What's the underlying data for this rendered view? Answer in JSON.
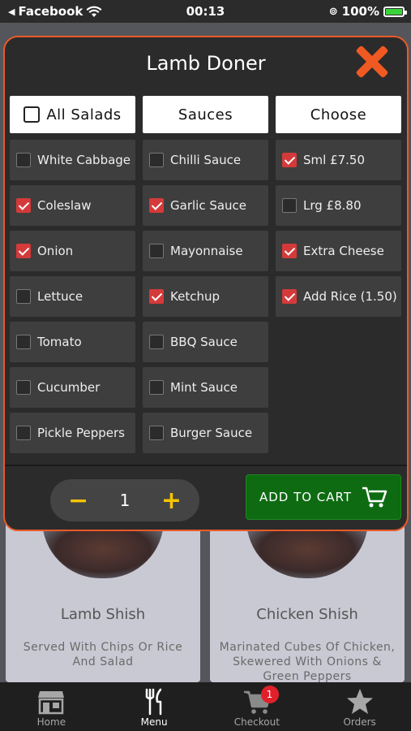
{
  "status_bar": {
    "back_app": "Facebook",
    "time": "00:13",
    "battery": "100%"
  },
  "modal": {
    "title": "Lamb Doner",
    "columns": [
      {
        "header": "All Salads",
        "items": [
          {
            "label": "White Cabbage",
            "checked": false
          },
          {
            "label": "Coleslaw",
            "checked": true
          },
          {
            "label": "Onion",
            "checked": true
          },
          {
            "label": "Lettuce",
            "checked": false
          },
          {
            "label": "Tomato",
            "checked": false
          },
          {
            "label": "Cucumber",
            "checked": false
          },
          {
            "label": "Pickle Peppers",
            "checked": false
          }
        ]
      },
      {
        "header": "Sauces",
        "items": [
          {
            "label": "Chilli Sauce",
            "checked": false
          },
          {
            "label": "Garlic Sauce",
            "checked": true
          },
          {
            "label": "Mayonnaise",
            "checked": false
          },
          {
            "label": "Ketchup",
            "checked": true
          },
          {
            "label": "BBQ Sauce",
            "checked": false
          },
          {
            "label": "Mint Sauce",
            "checked": false
          },
          {
            "label": "Burger Sauce",
            "checked": false
          }
        ]
      },
      {
        "header": "Choose",
        "items": [
          {
            "label": "Sml £7.50",
            "checked": true
          },
          {
            "label": "Lrg £8.80",
            "checked": false
          },
          {
            "label": "Extra Cheese",
            "checked": true
          },
          {
            "label": "Add Rice (1.50)",
            "checked": true
          }
        ]
      }
    ],
    "quantity": "1",
    "quantity_minus": "−",
    "quantity_plus": "+",
    "add_to_cart_label": "ADD TO CART"
  },
  "background_cards": [
    {
      "title": "Lamb Shish",
      "description": "Served With Chips Or Rice And Salad"
    },
    {
      "title": "Chicken Shish",
      "description": "Marinated Cubes Of Chicken, Skewered With Onions & Green Peppers"
    }
  ],
  "tab_bar": {
    "tabs": [
      {
        "label": "Home",
        "icon": "store-icon"
      },
      {
        "label": "Menu",
        "icon": "fork-knife-icon"
      },
      {
        "label": "Checkout",
        "icon": "cart-icon"
      },
      {
        "label": "Orders",
        "icon": "star-icon"
      }
    ],
    "cart_badge": "1"
  },
  "colors": {
    "accent": "#e85a28",
    "checkbox_on": "#d43a3a",
    "add_to_cart": "#0e6b12",
    "qty_buttons": "#f5c400"
  }
}
